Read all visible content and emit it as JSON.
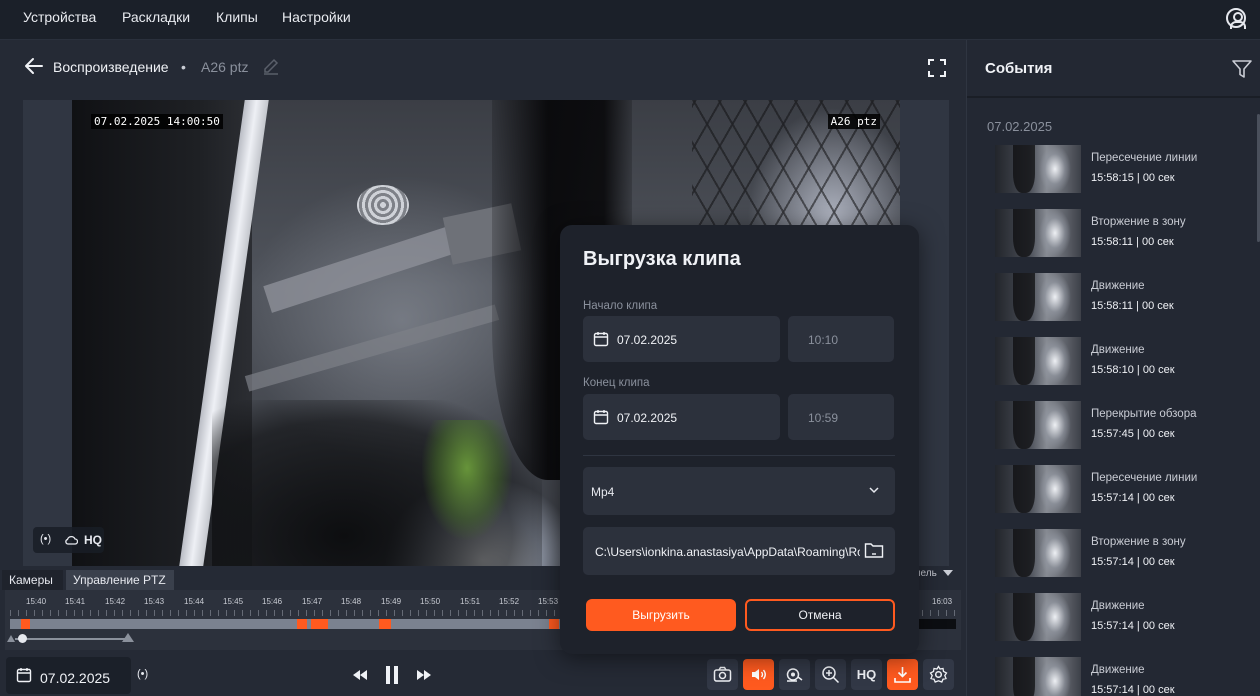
{
  "topbar": {
    "menu": [
      "Устройства",
      "Раскладки",
      "Клипы",
      "Настройки"
    ],
    "avatar_icon": "user-circle-icon"
  },
  "header": {
    "title": "Воспроизведение",
    "separator": "•",
    "camera_name": "A26 ptz"
  },
  "video": {
    "osd_datetime": "07.02.2025 14:00:50",
    "osd_camera": "A26 ptz",
    "badges": {
      "radio": "(•)",
      "hq": "HQ"
    }
  },
  "tabs": [
    "Камеры",
    "Управление PTZ"
  ],
  "panel_dropdown": "нель",
  "timeline": {
    "labels": [
      "15:40",
      "15:41",
      "15:42",
      "15:43",
      "15:44",
      "15:45",
      "15:46",
      "15:47",
      "15:48",
      "15:49",
      "15:50",
      "15:51",
      "15:52",
      "15:53",
      "16:03"
    ],
    "accent": "#ff5a1f"
  },
  "bottombar": {
    "date": "07.02.2025",
    "live_icon": "(•)",
    "hq": "HQ"
  },
  "sidebar": {
    "title": "События",
    "date": "07.02.2025",
    "events": [
      {
        "type": "Пересечение линии",
        "time": "15:58:15",
        "sep": "|",
        "dur": "00 сек"
      },
      {
        "type": "Вторжение в зону",
        "time": "15:58:11",
        "sep": "|",
        "dur": "00 сек"
      },
      {
        "type": "Движение",
        "time": "15:58:11",
        "sep": "|",
        "dur": "00 сек"
      },
      {
        "type": "Движение",
        "time": "15:58:10",
        "sep": "|",
        "dur": "00 сек"
      },
      {
        "type": "Перекрытие обзора",
        "time": "15:57:45",
        "sep": "|",
        "dur": "00 сек"
      },
      {
        "type": "Пересечение линии",
        "time": "15:57:14",
        "sep": "|",
        "dur": "00 сек"
      },
      {
        "type": "Вторжение в зону",
        "time": "15:57:14",
        "sep": "|",
        "dur": "00 сек"
      },
      {
        "type": "Движение",
        "time": "15:57:14",
        "sep": "|",
        "dur": "00 сек"
      },
      {
        "type": "Движение",
        "time": "15:57:14",
        "sep": "|",
        "dur": "00 сек"
      }
    ]
  },
  "dialog": {
    "title": "Выгрузка клипа",
    "start_label": "Начало клипа",
    "start_date": "07.02.2025",
    "start_time": "10:10",
    "end_label": "Конец клипа",
    "end_date": "07.02.2025",
    "end_time": "10:59",
    "format": "Mp4",
    "path": "C:\\Users\\ionkina.anastasiya\\AppData\\Roaming\\Ros",
    "export_label": "Выгрузить",
    "cancel_label": "Отмена"
  }
}
